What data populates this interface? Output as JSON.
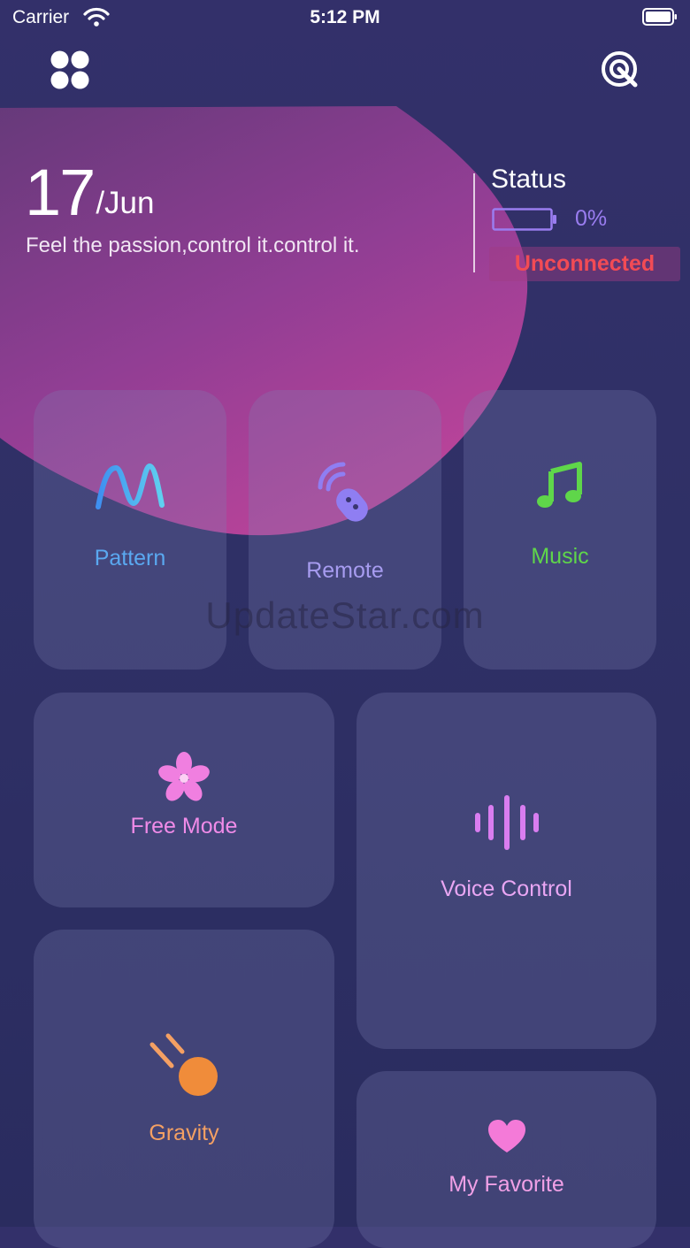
{
  "status_bar": {
    "carrier": "Carrier",
    "time": "5:12 PM"
  },
  "header": {
    "apps_icon": "grid-four-icon",
    "scan_icon": "scan-radar-icon"
  },
  "date": {
    "day": "17",
    "month": "/Jun",
    "tagline": "Feel the passion,control it.control it."
  },
  "status_panel": {
    "title": "Status",
    "battery_percent": "0%",
    "connection": "Unconnected"
  },
  "tiles": [
    {
      "label": "Pattern",
      "icon": "wave-icon",
      "color": "#5aa8f0"
    },
    {
      "label": "Remote",
      "icon": "remote-icon",
      "color": "#9b8ff3"
    },
    {
      "label": "Music",
      "icon": "music-note-icon",
      "color": "#5fd64a"
    },
    {
      "label": "Free Mode",
      "icon": "flower-icon",
      "color": "#f08be8"
    },
    {
      "label": "Voice Control",
      "icon": "sound-wave-icon",
      "color": "#e9a6f3"
    },
    {
      "label": "Gravity",
      "icon": "falling-ball-icon",
      "color": "#f4a063"
    },
    {
      "label": "My Favorite",
      "icon": "heart-icon",
      "color": "#f0a0e6"
    }
  ],
  "watermark": "UpdateStar.com"
}
